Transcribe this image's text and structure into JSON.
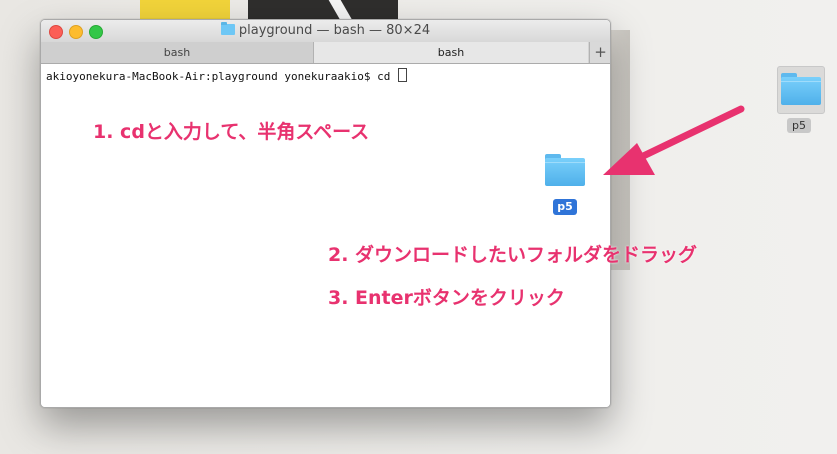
{
  "window": {
    "title": "playground — bash — 80×24",
    "title_icon": "folder-icon",
    "tabs": [
      {
        "label": "bash",
        "active": false
      },
      {
        "label": "bash",
        "active": true
      }
    ],
    "add_tab": "+"
  },
  "terminal": {
    "prompt": "akioyonekura-MacBook-Air:playground yonekuraakio$ cd "
  },
  "annotations": {
    "step1": "1. cdと入力して、半角スペース",
    "step2": "2. ダウンロードしたいフォルダをドラッグ",
    "step3": "3. Enterボタンをクリック"
  },
  "dragged_folder": {
    "label": "p5"
  },
  "desktop_folder": {
    "label": "p5"
  },
  "colors": {
    "annotation": "#e8326f",
    "folder": "#5ab6e6",
    "selected_label": "#2f74d8"
  }
}
